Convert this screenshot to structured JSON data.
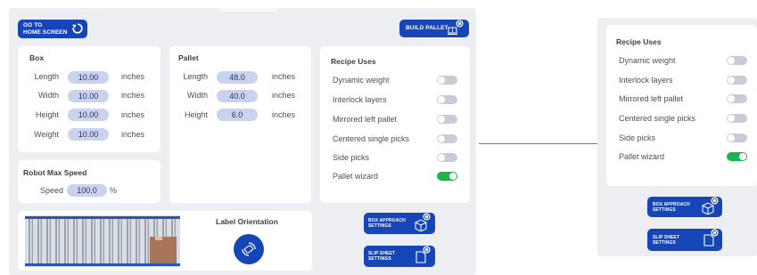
{
  "header": {
    "go_home_line1": "GO TO",
    "go_home_line2": "HOME SCREEN",
    "build_pallet": "BUILD PALLET"
  },
  "box": {
    "title": "Box",
    "rows": [
      {
        "label": "Length",
        "value": "10.00",
        "unit": "inches"
      },
      {
        "label": "Width",
        "value": "10.00",
        "unit": "inches"
      },
      {
        "label": "Height",
        "value": "10.00",
        "unit": "inches"
      },
      {
        "label": "Weight",
        "value": "10.00",
        "unit": "inches"
      }
    ]
  },
  "pallet": {
    "title": "Pallet",
    "rows": [
      {
        "label": "Length",
        "value": "48.0",
        "unit": "inches"
      },
      {
        "label": "Width",
        "value": "40.0",
        "unit": "inches"
      },
      {
        "label": "Height",
        "value": "6.0",
        "unit": "inches"
      }
    ]
  },
  "recipe": {
    "title": "Recipe Uses",
    "items": [
      {
        "label": "Dynamic weight",
        "on": false
      },
      {
        "label": "Interlock layers",
        "on": false
      },
      {
        "label": "Mirrored left pallet",
        "on": false
      },
      {
        "label": "Centered single picks",
        "on": false
      },
      {
        "label": "Side picks",
        "on": false
      },
      {
        "label": "Pallet wizard",
        "on": true
      }
    ]
  },
  "speed": {
    "title": "Robot Max Speed",
    "label": "Speed",
    "value": "100.0",
    "unit": "%"
  },
  "label_orientation": {
    "title": "Label Orientation"
  },
  "settings": {
    "box_approach_line1": "BOX APPROACH",
    "box_approach_line2": "SETTINGS",
    "slip_sheet_line1": "SLIP SHEET",
    "slip_sheet_line2": "SETTINGS"
  },
  "colors": {
    "accent": "#1645b8",
    "toggle_on": "#1db34f",
    "toggle_off": "#c8ccd6",
    "pill": "#c9d3ee",
    "panel_bg": "#eceef1"
  },
  "icons": [
    "refresh-icon",
    "pallet-build-icon",
    "gear-badge-icon",
    "box-approach-icon",
    "slip-sheet-icon",
    "rotate-label-icon",
    "conveyor-image"
  ]
}
